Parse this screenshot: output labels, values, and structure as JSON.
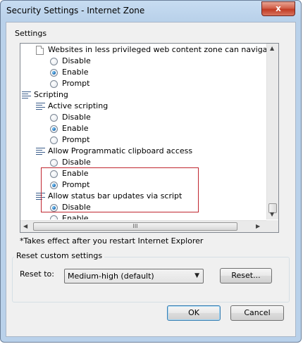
{
  "window": {
    "title": "Security Settings - Internet Zone",
    "close_label": "x"
  },
  "settings_group": {
    "label": "Settings"
  },
  "tree": {
    "items": [
      {
        "kind": "setting",
        "icon": "document-icon",
        "label": "Websites in less privileged web content zone can navigate in"
      },
      {
        "kind": "option",
        "label": "Disable",
        "checked": false
      },
      {
        "kind": "option",
        "label": "Enable",
        "checked": true
      },
      {
        "kind": "option",
        "label": "Prompt",
        "checked": false
      },
      {
        "kind": "category",
        "icon": "settings-icon",
        "label": "Scripting"
      },
      {
        "kind": "setting",
        "icon": "settings-icon",
        "label": "Active scripting"
      },
      {
        "kind": "option",
        "label": "Disable",
        "checked": false
      },
      {
        "kind": "option",
        "label": "Enable",
        "checked": true
      },
      {
        "kind": "option",
        "label": "Prompt",
        "checked": false
      },
      {
        "kind": "setting",
        "icon": "settings-icon",
        "label": "Allow Programmatic clipboard access"
      },
      {
        "kind": "option",
        "label": "Disable",
        "checked": false
      },
      {
        "kind": "option",
        "label": "Enable",
        "checked": false
      },
      {
        "kind": "option",
        "label": "Prompt",
        "checked": true
      },
      {
        "kind": "setting",
        "icon": "settings-icon",
        "label": "Allow status bar updates via script"
      },
      {
        "kind": "option",
        "label": "Disable",
        "checked": true
      },
      {
        "kind": "option",
        "label": "Enable",
        "checked": false
      }
    ],
    "hscroll_grip": "III"
  },
  "note": "*Takes effect after you restart Internet Explorer",
  "reset": {
    "group_title": "Reset custom settings",
    "reset_to_label": "Reset to:",
    "selected": "Medium-high (default)",
    "reset_button": "Reset..."
  },
  "buttons": {
    "ok": "OK",
    "cancel": "Cancel"
  }
}
